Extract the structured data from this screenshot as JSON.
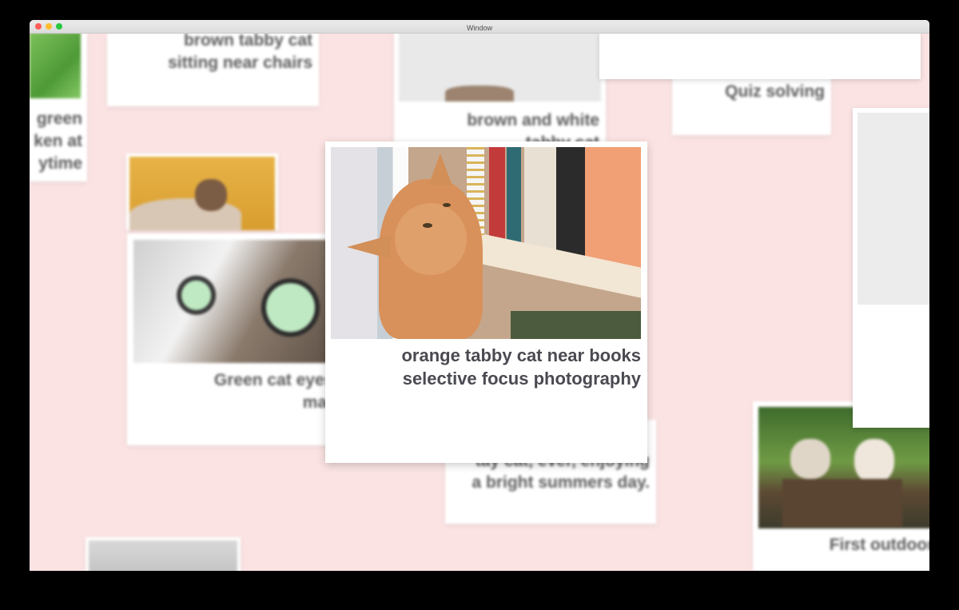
{
  "window": {
    "title": "Window"
  },
  "cards": {
    "c1": {
      "caption": [
        "brown tabby cat",
        "sitting near chairs"
      ]
    },
    "c2": {
      "caption": [
        "brown and white",
        "tabby cat"
      ]
    },
    "c3": {
      "caption": [
        "Quiz solving"
      ]
    },
    "c4": {
      "caption": [
        "green",
        "ken at",
        "ytime"
      ]
    },
    "c5": {
      "caption": [
        "Green cat eyes i",
        "macr"
      ]
    },
    "c6": {
      "caption": [
        "tay cat, ever, enjoying",
        "a bright summers day."
      ]
    },
    "c7": {
      "caption": [
        "First outdoor o"
      ]
    },
    "focused": {
      "caption": [
        "orange tabby cat near books",
        "selective focus photography"
      ]
    }
  },
  "colors": {
    "background": "#fbe3e3",
    "caption": "#5c5c5c",
    "focused_caption": "#4a4a52"
  }
}
